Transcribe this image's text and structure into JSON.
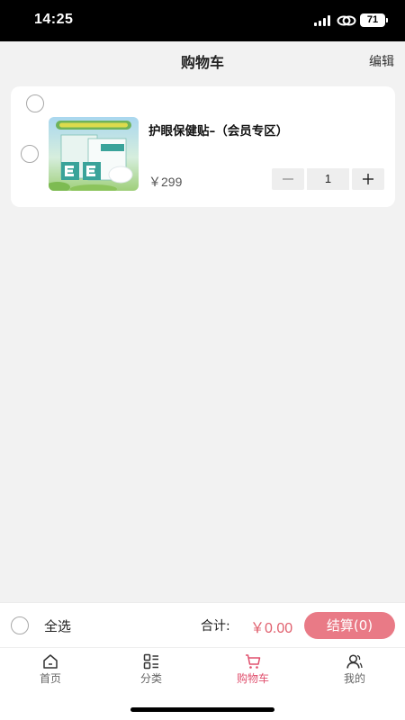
{
  "status_bar": {
    "time": "14:25",
    "battery": "71"
  },
  "header": {
    "title": "购物车",
    "edit_label": "编辑"
  },
  "cart": {
    "items": [
      {
        "name": "护眼保健贴–（会员专区）",
        "price": "￥299",
        "quantity": "1"
      }
    ]
  },
  "checkout": {
    "select_all_label": "全选",
    "total_label": "合计:",
    "total_value": "￥0.00",
    "checkout_label": "结算(0)"
  },
  "tabs": [
    {
      "label": "首页",
      "icon": "home-icon"
    },
    {
      "label": "分类",
      "icon": "category-icon"
    },
    {
      "label": "购物车",
      "icon": "cart-icon",
      "active": true
    },
    {
      "label": "我的",
      "icon": "user-icon"
    }
  ],
  "colors": {
    "accent": "#e0506e",
    "checkout_button": "#e97a86"
  }
}
